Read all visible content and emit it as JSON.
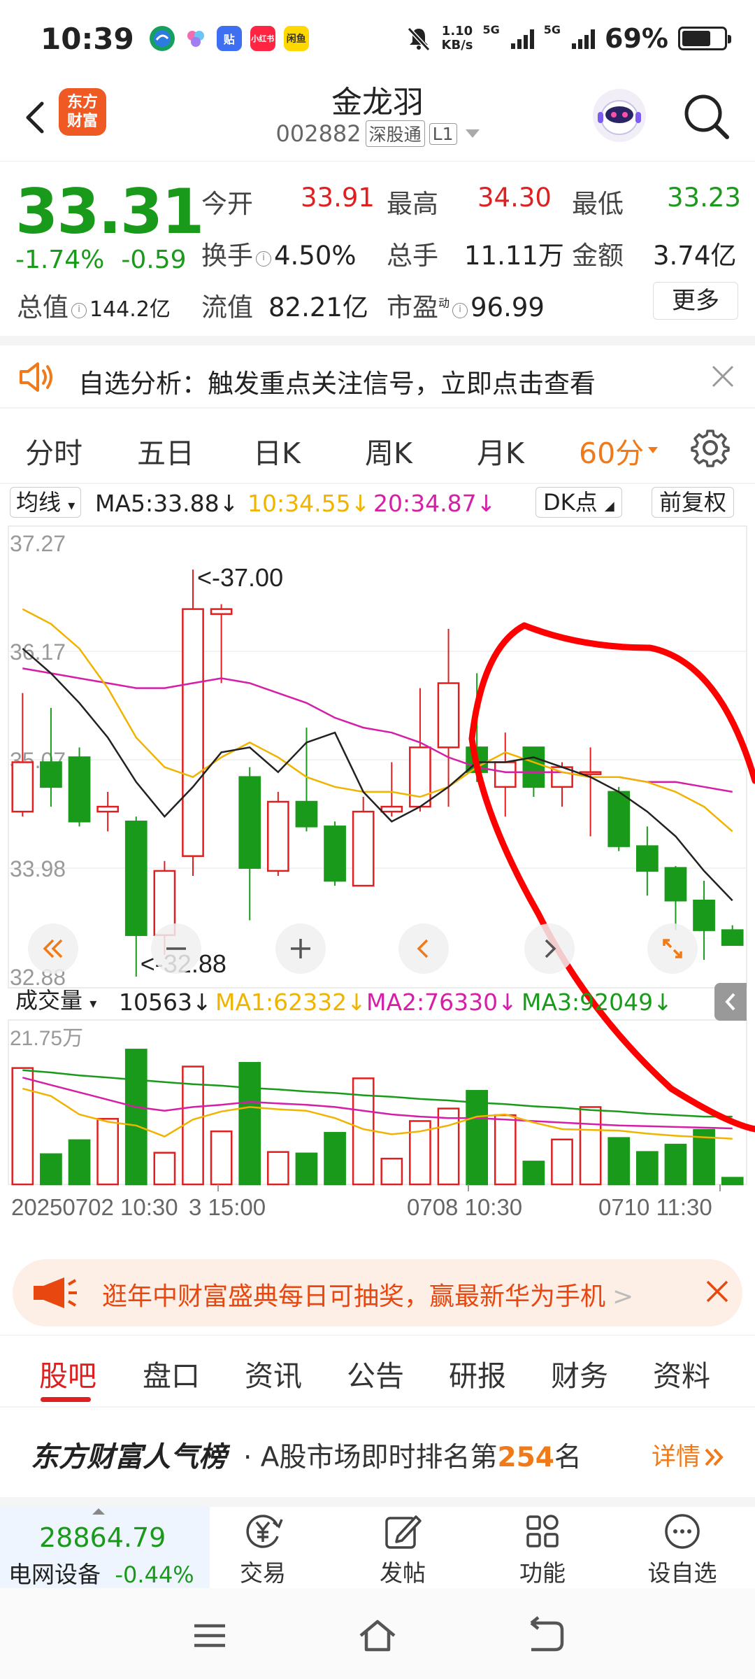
{
  "status_bar": {
    "time": "10:39",
    "net_speed_value": "1.10",
    "net_speed_unit": "KB/s",
    "sig1": "5G",
    "sig2": "5G",
    "battery": "69%",
    "battery_level": 0.69,
    "apps": [
      "app-1",
      "app-2",
      "贴",
      "小红书",
      "闲鱼"
    ]
  },
  "header": {
    "back_icon": "chevron-left-icon",
    "logo_line1": "东方",
    "logo_line2": "财富",
    "stock_name": "金龙羽",
    "stock_code": "002882",
    "exchange_tag": "深股通",
    "level_tag": "L1"
  },
  "quote": {
    "price": "33.31",
    "change_pct": "-1.74%",
    "change_abs": "-0.59",
    "open_label": "今开",
    "open_value": "33.91",
    "high_label": "最高",
    "high_value": "34.30",
    "low_label": "最低",
    "low_value": "33.23",
    "turnover_label": "换手",
    "turnover_value": "4.50%",
    "volume_label": "总手",
    "volume_value": "11.11万",
    "amount_label": "金额",
    "amount_value": "3.74亿",
    "mktcap_label": "总值",
    "mktcap_value": "144.2亿",
    "float_label": "流值",
    "float_value": "82.21亿",
    "pe_label": "市盈",
    "pe_sup": "动",
    "pe_value": "96.99",
    "more_label": "更多",
    "info_glyph": "i"
  },
  "notice": {
    "text": "自选分析：触发重点关注信号，立即点击查看"
  },
  "period_tabs": [
    "分时",
    "五日",
    "日K",
    "周K",
    "月K",
    "60分"
  ],
  "ma_bar": {
    "selector": "均线",
    "ma5": "MA5:33.88",
    "ma10": "10:34.55",
    "ma20": "20:34.87",
    "dk": "DK点",
    "adjust": "前复权",
    "arrow": "↓"
  },
  "volume_bar": {
    "selector": "成交量",
    "current": "10563",
    "ma1": "MA1:62332",
    "ma2": "MA2:76330",
    "ma3": "MA3:92049",
    "arrow": "↓"
  },
  "chart_labels": {
    "y_ticks": [
      "37.27",
      "36.17",
      "35.07",
      "33.98",
      "32.88"
    ],
    "vol_max": "21.75万",
    "max_note": "<-37.00",
    "min_note": "<-32.88",
    "x_ticks": [
      "20250702 10:30",
      "3 15:00",
      "0708 10:30",
      "0710 11:30"
    ]
  },
  "colors": {
    "up": "#e02020",
    "down": "#1a9a1a",
    "ma5": "#222222",
    "ma10": "#f0b400",
    "ma20": "#d41fa6",
    "accent": "#f07a1a"
  },
  "chart_data": {
    "type": "candlestick",
    "y_range": [
      32.88,
      37.27
    ],
    "candles": [
      {
        "o": 34.55,
        "c": 35.05,
        "h": 35.75,
        "l": 34.5
      },
      {
        "o": 35.05,
        "c": 34.8,
        "h": 35.6,
        "l": 34.6
      },
      {
        "o": 35.1,
        "c": 34.45,
        "h": 35.2,
        "l": 34.4
      },
      {
        "o": 34.55,
        "c": 34.6,
        "h": 34.75,
        "l": 34.35
      },
      {
        "o": 34.45,
        "c": 33.3,
        "h": 34.5,
        "l": 32.88
      },
      {
        "o": 33.3,
        "c": 33.95,
        "h": 34.05,
        "l": 33.1
      },
      {
        "o": 34.1,
        "c": 36.6,
        "h": 37.0,
        "l": 33.9
      },
      {
        "o": 36.55,
        "c": 36.6,
        "h": 36.65,
        "l": 35.85
      },
      {
        "o": 34.9,
        "c": 33.98,
        "h": 35.0,
        "l": 33.45
      },
      {
        "o": 33.95,
        "c": 34.65,
        "h": 34.75,
        "l": 33.9
      },
      {
        "o": 34.65,
        "c": 34.4,
        "h": 35.4,
        "l": 34.35
      },
      {
        "o": 34.4,
        "c": 33.85,
        "h": 34.45,
        "l": 33.8
      },
      {
        "o": 33.8,
        "c": 34.55,
        "h": 34.7,
        "l": 33.8
      },
      {
        "o": 34.55,
        "c": 34.6,
        "h": 35.05,
        "l": 34.5
      },
      {
        "o": 34.6,
        "c": 35.2,
        "h": 35.8,
        "l": 34.55
      },
      {
        "o": 35.2,
        "c": 35.85,
        "h": 36.4,
        "l": 34.6
      },
      {
        "o": 35.2,
        "c": 34.95,
        "h": 35.95,
        "l": 34.85
      },
      {
        "o": 34.8,
        "c": 35.05,
        "h": 35.35,
        "l": 34.5
      },
      {
        "o": 35.2,
        "c": 34.8,
        "h": 35.2,
        "l": 34.7
      },
      {
        "o": 34.8,
        "c": 35.0,
        "h": 35.05,
        "l": 34.6
      },
      {
        "o": 34.95,
        "c": 34.95,
        "h": 35.2,
        "l": 34.3
      },
      {
        "o": 34.75,
        "c": 34.2,
        "h": 34.8,
        "l": 34.15
      },
      {
        "o": 34.2,
        "c": 33.95,
        "h": 34.4,
        "l": 33.7
      },
      {
        "o": 33.98,
        "c": 33.65,
        "h": 34.0,
        "l": 33.35
      },
      {
        "o": 33.65,
        "c": 33.35,
        "h": 33.85,
        "l": 33.05
      },
      {
        "o": 33.35,
        "c": 33.2,
        "h": 33.4,
        "l": 33.2
      }
    ],
    "ma5": [
      36.2,
      35.95,
      35.65,
      35.3,
      34.85,
      34.5,
      34.8,
      35.15,
      35.2,
      34.95,
      35.25,
      35.35,
      34.75,
      34.45,
      34.6,
      34.8,
      35.05,
      35.05,
      35.1,
      35.0,
      34.9,
      34.75,
      34.55,
      34.3,
      33.95,
      33.65
    ],
    "ma10": [
      36.6,
      36.45,
      36.2,
      35.8,
      35.3,
      35.0,
      34.9,
      35.1,
      35.25,
      35.1,
      34.9,
      34.8,
      34.75,
      34.75,
      34.7,
      34.8,
      35.0,
      35.15,
      35.05,
      34.95,
      34.9,
      34.9,
      34.85,
      34.75,
      34.6,
      34.35
    ],
    "ma20": [
      36.0,
      35.95,
      35.9,
      35.85,
      35.8,
      35.8,
      35.85,
      35.9,
      35.85,
      35.75,
      35.65,
      35.5,
      35.4,
      35.35,
      35.25,
      35.1,
      35.0,
      34.95,
      34.95,
      34.95,
      34.9,
      34.9,
      34.85,
      34.85,
      34.8,
      34.75
    ],
    "vol_range": [
      0,
      21.75
    ],
    "volumes": [
      15.8,
      4.1,
      6.0,
      8.9,
      18.3,
      4.3,
      16.0,
      7.2,
      16.5,
      4.4,
      4.2,
      7.0,
      14.4,
      3.5,
      8.6,
      10.3,
      12.7,
      9.4,
      3.1,
      6.1,
      10.5,
      6.3,
      4.4,
      5.4,
      7.4,
      0.9
    ],
    "vol_ma1": [
      13.0,
      12.0,
      9.5,
      8.5,
      8.0,
      6.5,
      8.8,
      9.9,
      10.5,
      10.2,
      10.0,
      9.0,
      7.5,
      6.8,
      7.2,
      8.0,
      9.2,
      9.5,
      8.4,
      7.5,
      7.4,
      7.3,
      6.9,
      6.6,
      6.4,
      6.2
    ],
    "vol_ma2": [
      14.5,
      13.5,
      12.5,
      11.5,
      10.5,
      10.0,
      10.5,
      10.8,
      11.2,
      11.0,
      10.8,
      10.5,
      10.0,
      9.5,
      9.2,
      9.0,
      9.0,
      8.8,
      8.6,
      8.4,
      8.2,
      8.0,
      7.9,
      7.8,
      7.7,
      7.6
    ],
    "vol_ma3": [
      15.5,
      15.2,
      14.8,
      14.5,
      14.2,
      13.9,
      13.6,
      13.4,
      13.1,
      12.9,
      12.6,
      12.4,
      12.1,
      11.9,
      11.6,
      11.4,
      11.1,
      10.9,
      10.6,
      10.4,
      10.1,
      9.9,
      9.6,
      9.4,
      9.2,
      9.2
    ]
  },
  "promo": {
    "text": "逛年中财富盛典每日可抽奖，赢最新华为手机",
    "arrow": ">"
  },
  "section_tabs": [
    "股吧",
    "盘口",
    "资讯",
    "公告",
    "研报",
    "财务",
    "资料"
  ],
  "rank": {
    "brand": "东方财富人气榜",
    "text_pre": "· A股市场即时排名第",
    "rank_num": "254",
    "text_post": "名",
    "detail": "详情"
  },
  "bottom_nav": {
    "index_value": "28864.79",
    "index_name": "电网设备",
    "index_change": "-0.44%",
    "items": [
      "交易",
      "发帖",
      "功能",
      "设自选"
    ]
  }
}
